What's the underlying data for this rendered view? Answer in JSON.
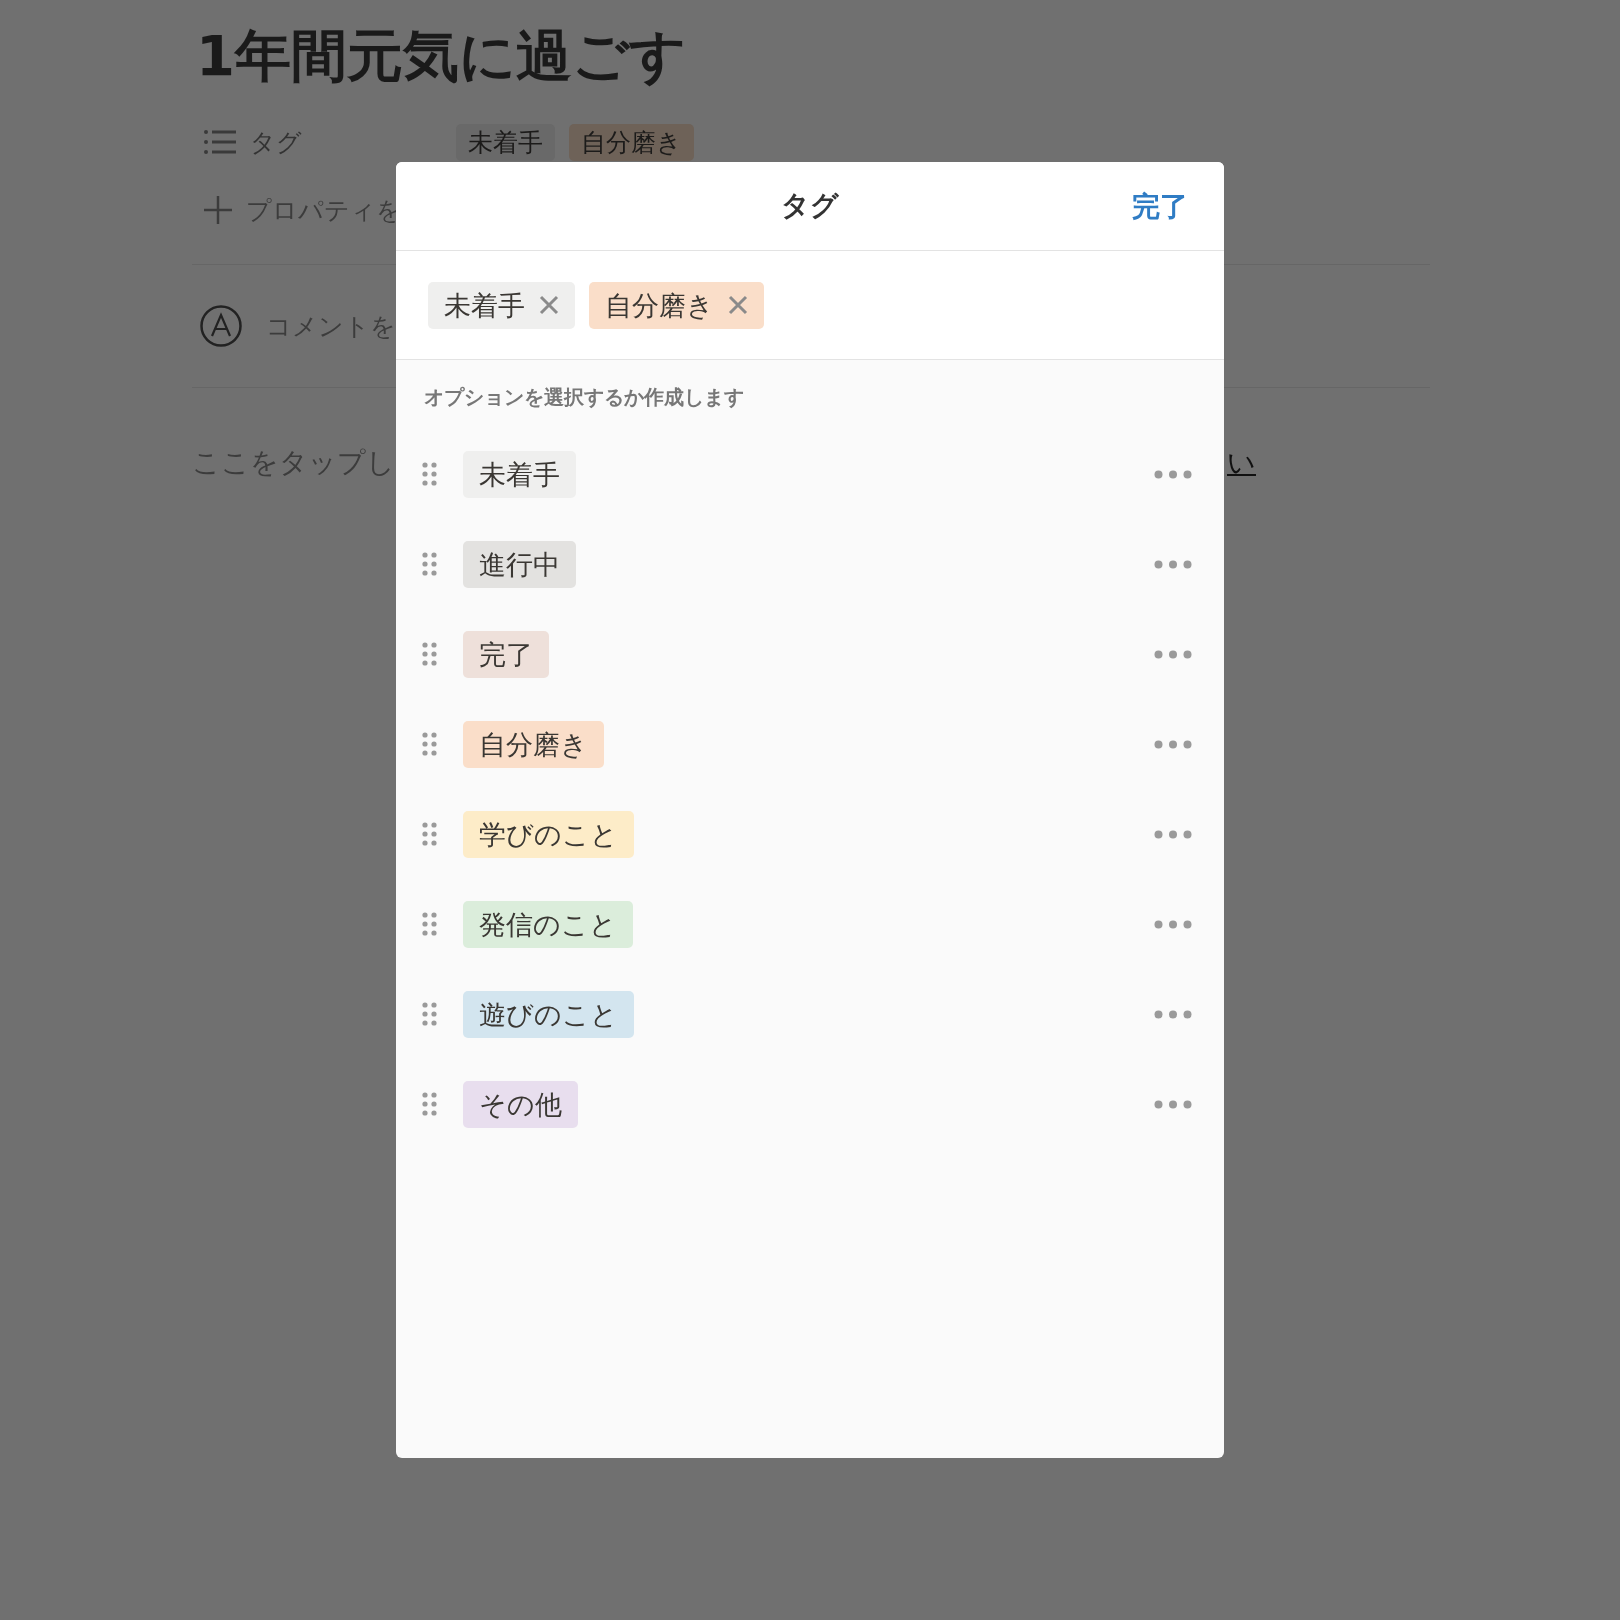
{
  "page": {
    "title": "1年間元気に過ごす",
    "properties": [
      {
        "kind": "tags",
        "label": "タグ",
        "tags": [
          {
            "label": "未着手",
            "color": "#696969"
          },
          {
            "label": "自分磨き",
            "color": "#6e6258"
          }
        ]
      },
      {
        "kind": "add",
        "label": "プロパティを"
      }
    ],
    "comment_placeholder": "コメントを",
    "body_hint": "ここをタップし",
    "body_hint_end": "い"
  },
  "dialog": {
    "title": "タグ",
    "done": "完了",
    "selected_tags": [
      {
        "label": "未着手",
        "color": "#efefee"
      },
      {
        "label": "自分磨き",
        "color": "#fadec9"
      }
    ],
    "section_label": "オプションを選択するか作成します",
    "options": [
      {
        "label": "未着手",
        "color": "#efefee"
      },
      {
        "label": "進行中",
        "color": "#e3e2e0"
      },
      {
        "label": "完了",
        "color": "#eee0da"
      },
      {
        "label": "自分磨き",
        "color": "#fadec9"
      },
      {
        "label": "学びのこと",
        "color": "#fdecc8"
      },
      {
        "label": "発信のこと",
        "color": "#dbeddb"
      },
      {
        "label": "遊びのこと",
        "color": "#d3e5ef"
      },
      {
        "label": "その他",
        "color": "#e8deee"
      }
    ]
  }
}
